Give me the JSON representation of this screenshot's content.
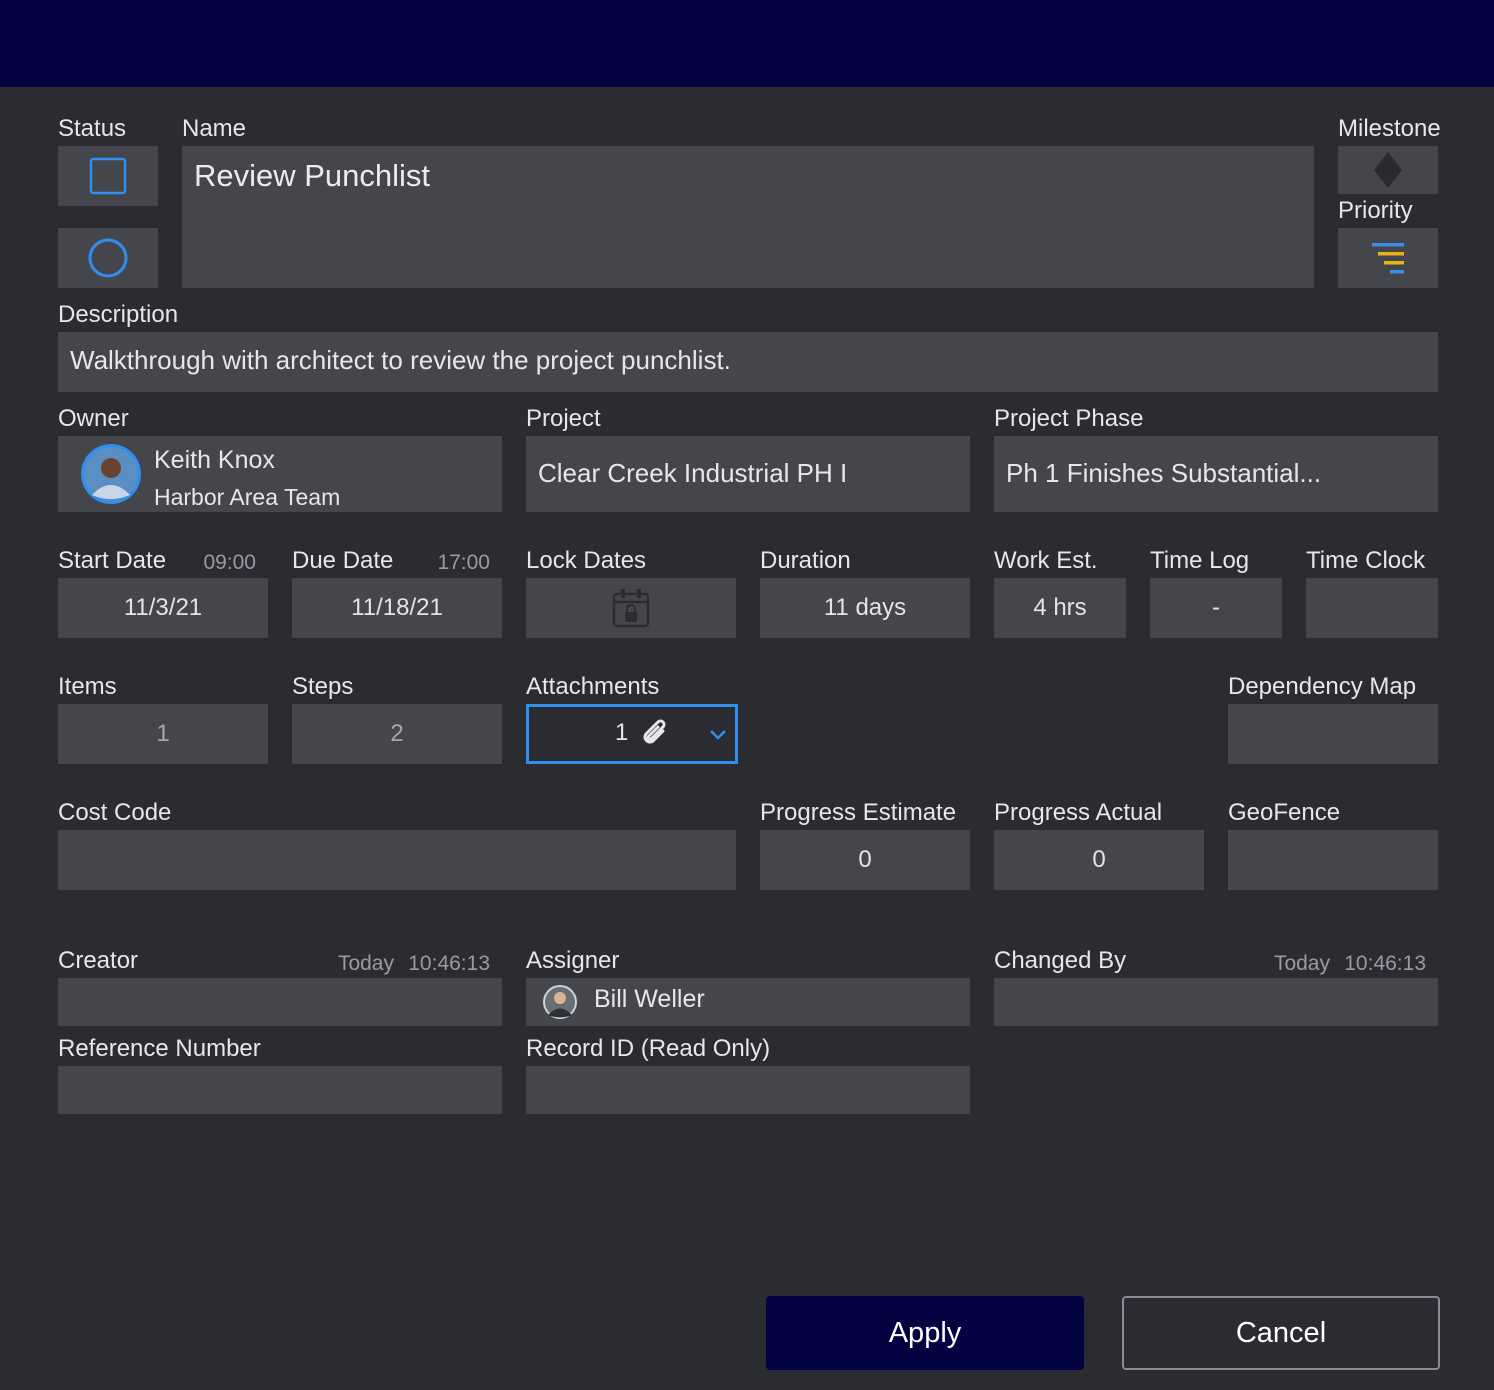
{
  "colors": {
    "topbar": "#020340",
    "background": "#2b2c31",
    "field": "#45464c",
    "accent": "#2f8ff0",
    "priority_bars": [
      "#3a8ee6",
      "#e6b416",
      "#3a8ee6"
    ]
  },
  "labels": {
    "status": "Status",
    "name": "Name",
    "milestone": "Milestone",
    "priority": "Priority",
    "description": "Description",
    "owner": "Owner",
    "project": "Project",
    "project_phase": "Project Phase",
    "start_date": "Start Date",
    "due_date": "Due Date",
    "lock_dates": "Lock Dates",
    "duration": "Duration",
    "work_est": "Work Est.",
    "time_log": "Time Log",
    "time_clock": "Time Clock",
    "items": "Items",
    "steps": "Steps",
    "attachments": "Attachments",
    "dependency_map": "Dependency Map",
    "cost_code": "Cost Code",
    "progress_estimate": "Progress Estimate",
    "progress_actual": "Progress Actual",
    "geofence": "GeoFence",
    "creator": "Creator",
    "assigner": "Assigner",
    "changed_by": "Changed By",
    "reference_number": "Reference Number",
    "record_id": "Record ID (Read Only)"
  },
  "values": {
    "name": "Review Punchlist",
    "description": "Walkthrough with architect to review the project punchlist.",
    "owner_name": "Keith Knox",
    "owner_team": "Harbor Area Team",
    "project": "Clear Creek Industrial PH I",
    "project_phase": "Ph 1 Finishes Substantial...",
    "start_time": "09:00",
    "start_date": "11/3/21",
    "due_time": "17:00",
    "due_date": "11/18/21",
    "duration": "11 days",
    "work_est": "4 hrs",
    "time_log": "-",
    "time_clock": "",
    "items": "1",
    "steps": "2",
    "attachments": "1",
    "dependency_map": "",
    "cost_code": "",
    "progress_estimate": "0",
    "progress_actual": "0",
    "geofence": "",
    "creator_day": "Today",
    "creator_time": "10:46:13",
    "creator": "",
    "assigner": "Bill Weller",
    "changed_day": "Today",
    "changed_time": "10:46:13",
    "changed_by": "",
    "reference_number": "",
    "record_id": ""
  },
  "icons": {
    "status_square": "square-checkbox-icon",
    "status_circle": "circle-icon",
    "milestone": "diamond-icon",
    "priority": "priority-filter-icon",
    "lock": "calendar-lock-icon",
    "attachment": "paperclip-icon",
    "dropdown": "chevron-down-icon",
    "owner_avatar": "avatar",
    "assigner_avatar": "avatar"
  },
  "buttons": {
    "apply": "Apply",
    "cancel": "Cancel"
  }
}
